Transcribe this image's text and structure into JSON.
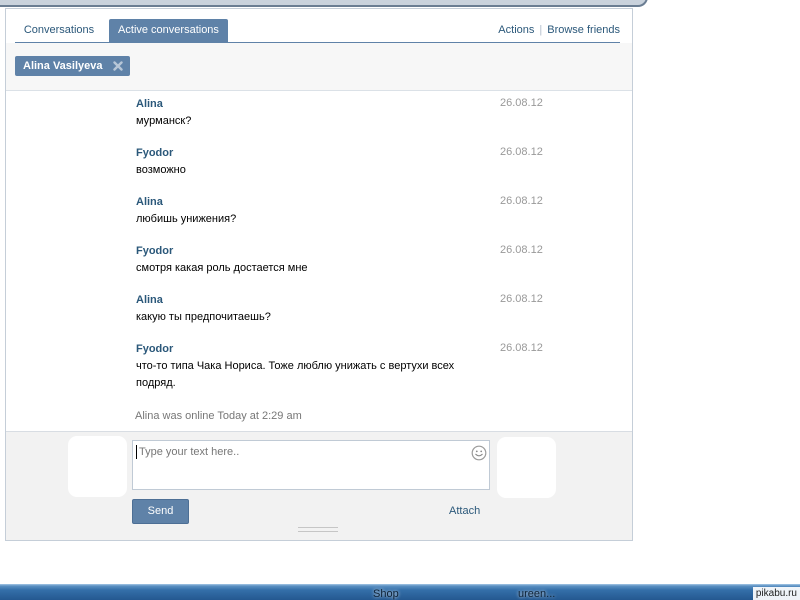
{
  "tabs": [
    {
      "label": "Conversations",
      "active": false
    },
    {
      "label": "Active conversations",
      "active": true
    }
  ],
  "header_links": {
    "actions": "Actions",
    "separator": "|",
    "browse_friends": "Browse friends"
  },
  "recipient_chip": {
    "name": "Alina Vasilyeva",
    "close_icon": "close-icon"
  },
  "messages": [
    {
      "author": "Alina",
      "date": "26.08.12",
      "text": "мурманск?"
    },
    {
      "author": "Fyodor",
      "date": "26.08.12",
      "text": "возможно"
    },
    {
      "author": "Alina",
      "date": "26.08.12",
      "text": "любишь унижения?"
    },
    {
      "author": "Fyodor",
      "date": "26.08.12",
      "text": "смотря какая роль достается мне"
    },
    {
      "author": "Alina",
      "date": "26.08.12",
      "text": "какую ты предпочитаешь?"
    },
    {
      "author": "Fyodor",
      "date": "26.08.12",
      "text": "что-то типа Чака Нориса. Тоже люблю унижать с вертухи всех подряд."
    }
  ],
  "online_status": "Alina was online Today at 2:29 am",
  "composer": {
    "placeholder": "Type your text here..",
    "emoji_icon": "smiley-icon",
    "send_label": "Send",
    "attach_label": "Attach"
  },
  "taskbar": {
    "items": [
      "Shop",
      "ureen..."
    ]
  },
  "watermark": "pikabu.ru",
  "colors": {
    "accent": "#5f82a8",
    "link": "#2b587a",
    "date": "#999999",
    "muted": "#777777"
  }
}
